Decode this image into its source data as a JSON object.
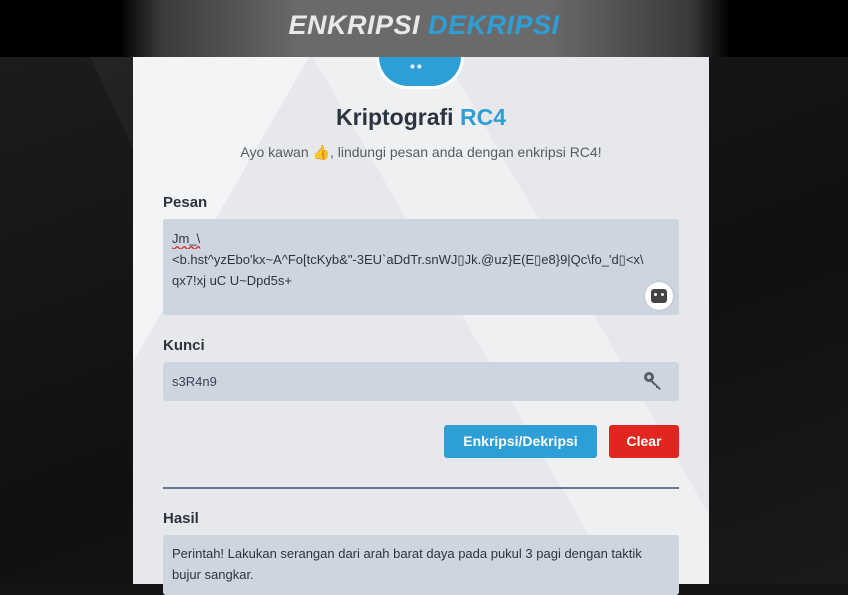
{
  "header": {
    "title_part1": "ENKRIPSI",
    "title_part2": "DEKRIPSI"
  },
  "page": {
    "heading_main": "Kriptografi",
    "heading_accent": "RC4",
    "subtitle_before": "Ayo kawan",
    "subtitle_emoji": "👍",
    "subtitle_after": ", lindungi pesan anda dengan enkripsi RC4!"
  },
  "message": {
    "label": "Pesan",
    "line1": "Jm_\\",
    "line2": "<b.hst^yzEbo'kx~A^Fo[tcKyb&\"-3EU`aDdTr.snWJ▯Jk.@uz}E(E▯e8}9|Qc\\fo_'d▯<x\\",
    "line3": "qx7!xj uC U~Dpd5s+"
  },
  "key": {
    "label": "Kunci",
    "value": "s3R4n9"
  },
  "buttons": {
    "encrypt": "Enkripsi/Dekripsi",
    "clear": "Clear"
  },
  "result": {
    "label": "Hasil",
    "text": "Perintah! Lakukan serangan dari arah barat daya pada pukul 3 pagi dengan taktik bujur sangkar."
  },
  "colors": {
    "accent": "#2e9fd6",
    "danger": "#e0261f",
    "field_bg": "#cdd5e1"
  },
  "icons": [
    "shield-icon",
    "key-icon",
    "grammarly-icon"
  ]
}
